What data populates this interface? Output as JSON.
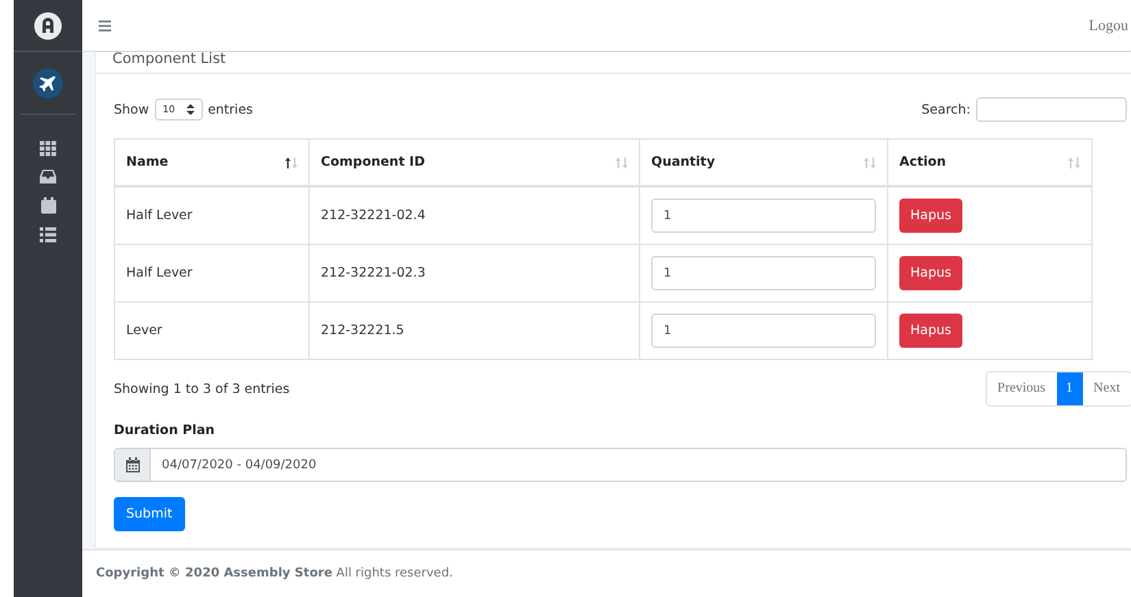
{
  "topbar": {
    "logout": "Logou"
  },
  "card": {
    "title": "Component List"
  },
  "length": {
    "label_before": "Show",
    "value": "10",
    "label_after": "entries"
  },
  "search": {
    "label": "Search:"
  },
  "table": {
    "columns": [
      {
        "label": "Name",
        "sorted": true
      },
      {
        "label": "Component ID",
        "sorted": false
      },
      {
        "label": "Quantity",
        "sorted": false
      },
      {
        "label": "Action",
        "sorted": false
      }
    ],
    "rows": [
      {
        "name": "Half Lever",
        "component_id": "212-32221-02.4",
        "quantity": "1",
        "action": "Hapus"
      },
      {
        "name": "Half Lever",
        "component_id": "212-32221-02.3",
        "quantity": "1",
        "action": "Hapus"
      },
      {
        "name": "Lever",
        "component_id": "212-32221.5",
        "quantity": "1",
        "action": "Hapus"
      }
    ]
  },
  "info": "Showing 1 to 3 of 3 entries",
  "pagination": [
    {
      "label": "Previous",
      "selected": false
    },
    {
      "label": "1",
      "selected": true
    },
    {
      "label": "Next",
      "selected": false
    }
  ],
  "duration": {
    "label": "Duration Plan",
    "value": "04/07/2020 - 04/09/2020"
  },
  "submit": "Submit",
  "footer": "**Copyright © 2020 Assembly Store** All rights reserved."
}
